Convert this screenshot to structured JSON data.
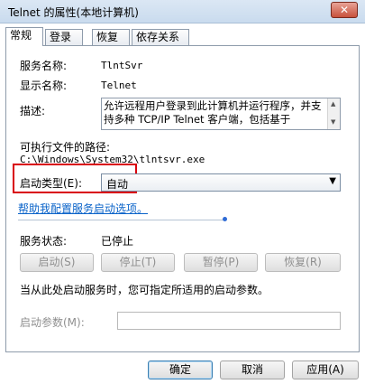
{
  "window": {
    "title": "Telnet 的属性(本地计算机)",
    "close_label": "✕"
  },
  "tabs": [
    "常规",
    "登录",
    "恢复",
    "依存关系"
  ],
  "general": {
    "service_name_label": "服务名称:",
    "service_name_value": "TlntSvr",
    "display_name_label": "显示名称:",
    "display_name_value": "Telnet",
    "description_label": "描述:",
    "description_value": "允许远程用户登录到此计算机并运行程序，并支持多种 TCP/IP Telnet 客户端，包括基于",
    "path_label": "可执行文件的路径:",
    "path_value": "C:\\Windows\\System32\\tlntsvr.exe",
    "startup_type_label": "启动类型(E):",
    "startup_type_value": "自动",
    "help_link": "帮助我配置服务启动选项。",
    "status_label": "服务状态:",
    "status_value": "已停止",
    "start_button": "启动(S)",
    "stop_button": "停止(T)",
    "pause_button": "暂停(P)",
    "resume_button": "恢复(R)",
    "hint_text": "当从此处启动服务时，您可指定所适用的启动参数。",
    "params_label": "启动参数(M):"
  },
  "footer": {
    "ok_button": "确定",
    "cancel_button": "取消",
    "apply_button": "应用(A)"
  },
  "colors": {
    "highlight_box": "#d9000d",
    "link": "#0a63c9"
  }
}
